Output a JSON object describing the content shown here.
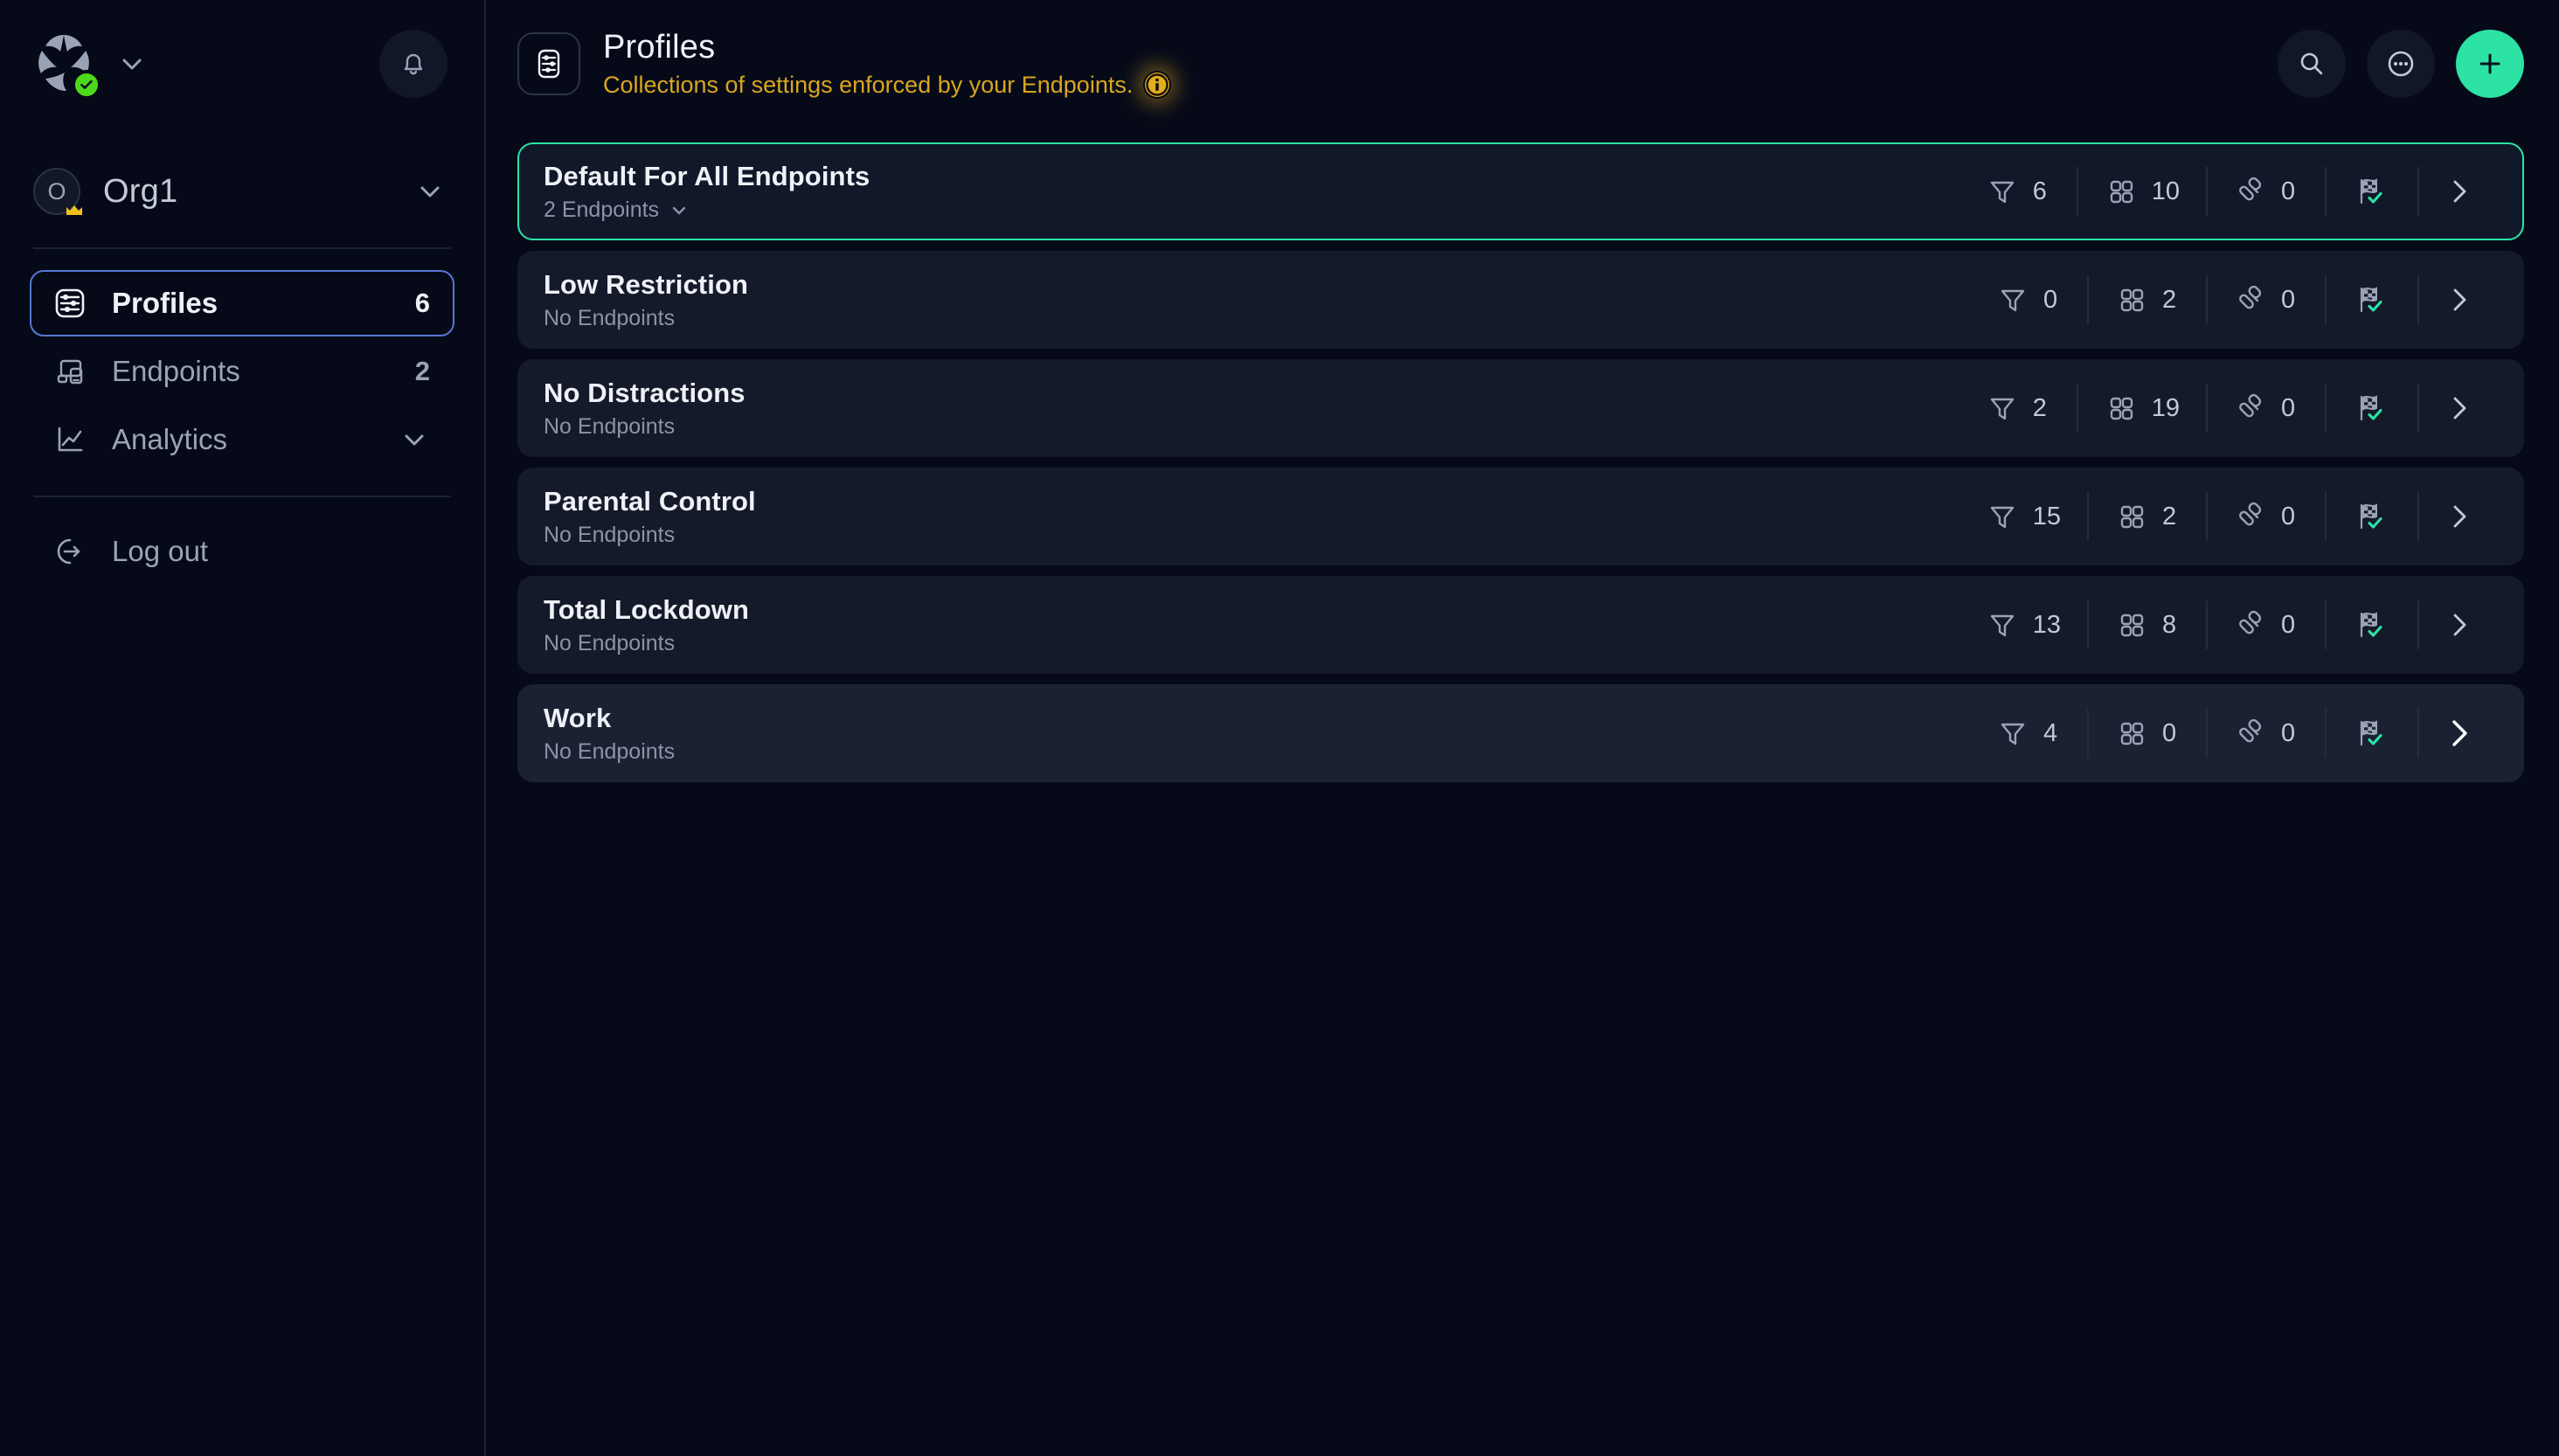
{
  "sidebar": {
    "logo": {
      "icon": "app-logo-icon",
      "status_badge": "check-badge-icon",
      "badge_color": "#4cd91a"
    },
    "logo_dropdown": "chevron-down-icon",
    "notifications": {
      "icon": "bell-icon"
    },
    "org": {
      "avatar_letter": "O",
      "name": "Org1",
      "crown": "crown-icon",
      "dropdown": "chevron-down-icon"
    },
    "items": [
      {
        "label": "Profiles",
        "icon": "sliders-icon",
        "count": "6",
        "active": true,
        "has_chevron": false
      },
      {
        "label": "Endpoints",
        "icon": "devices-icon",
        "count": "2",
        "active": false,
        "has_chevron": false
      },
      {
        "label": "Analytics",
        "icon": "line-chart-icon",
        "count": "",
        "active": false,
        "has_chevron": true
      }
    ],
    "logout": {
      "label": "Log out",
      "icon": "logout-icon"
    }
  },
  "header": {
    "icon": "sliders-page-icon",
    "title": "Profiles",
    "subtitle": "Collections of settings enforced by your Endpoints.",
    "subtitle_color": "#d9a620",
    "info_icon": "info-icon",
    "actions": [
      {
        "name": "search-button",
        "icon": "search-icon"
      },
      {
        "name": "more-options-button",
        "icon": "more-horizontal-icon"
      },
      {
        "name": "add-profile-button",
        "icon": "plus-icon",
        "color": "#2ce3a4"
      }
    ]
  },
  "profiles": {
    "columns": [
      "filters",
      "apps",
      "rules",
      "status"
    ],
    "rows": [
      {
        "title": "Default For All Endpoints",
        "endpoints_label": "2 Endpoints",
        "has_endpoints_dropdown": true,
        "filters": "6",
        "apps": "10",
        "rules": "0",
        "status": "flag-check",
        "selected": true,
        "hovered": false
      },
      {
        "title": "Low Restriction",
        "endpoints_label": "No Endpoints",
        "has_endpoints_dropdown": false,
        "filters": "0",
        "apps": "2",
        "rules": "0",
        "status": "flag-check",
        "selected": false,
        "hovered": false
      },
      {
        "title": "No Distractions",
        "endpoints_label": "No Endpoints",
        "has_endpoints_dropdown": false,
        "filters": "2",
        "apps": "19",
        "rules": "0",
        "status": "flag-check",
        "selected": false,
        "hovered": false
      },
      {
        "title": "Parental Control",
        "endpoints_label": "No Endpoints",
        "has_endpoints_dropdown": false,
        "filters": "15",
        "apps": "2",
        "rules": "0",
        "status": "flag-check",
        "selected": false,
        "hovered": false
      },
      {
        "title": "Total Lockdown",
        "endpoints_label": "No Endpoints",
        "has_endpoints_dropdown": false,
        "filters": "13",
        "apps": "8",
        "rules": "0",
        "status": "flag-check",
        "selected": false,
        "hovered": false
      },
      {
        "title": "Work",
        "endpoints_label": "No Endpoints",
        "has_endpoints_dropdown": false,
        "filters": "4",
        "apps": "0",
        "rules": "0",
        "status": "flag-check",
        "selected": false,
        "hovered": true
      }
    ]
  },
  "theme": {
    "background": "#060a18",
    "card": "#141a2a",
    "accent": "#2ce3a4",
    "active_border": "#5578d4",
    "muted_text": "#8b94a6",
    "icon": "#9aa3b5"
  }
}
